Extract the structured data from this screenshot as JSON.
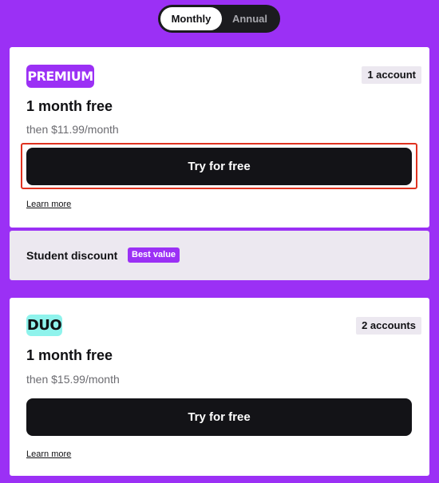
{
  "billing_toggle": {
    "options": [
      "Monthly",
      "Annual"
    ],
    "selected": "Monthly"
  },
  "plans": [
    {
      "name": "PREMIUM",
      "badge_color": "#9b30f5",
      "accounts": "1 account",
      "headline": "1 month free",
      "price": "then $11.99/month",
      "cta_label": "Try for free",
      "learn_more": "Learn more"
    },
    {
      "name": "DUO",
      "badge_color": "#8ff3ec",
      "accounts": "2 accounts",
      "headline": "1 month free",
      "price": "then $15.99/month",
      "cta_label": "Try for free",
      "learn_more": "Learn more"
    }
  ],
  "student": {
    "label": "Student discount",
    "badge": "Best value"
  },
  "colors": {
    "page_background": "#9b30f5",
    "button": "#131317",
    "highlight_outline": "#e0321f"
  }
}
